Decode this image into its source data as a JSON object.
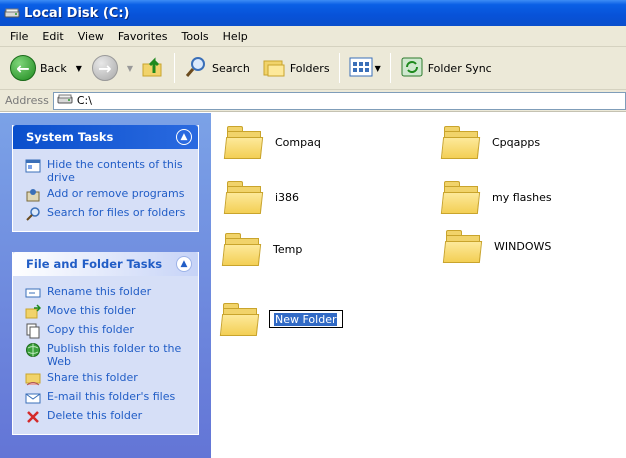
{
  "window": {
    "title": "Local Disk (C:)"
  },
  "menu": [
    "File",
    "Edit",
    "View",
    "Favorites",
    "Tools",
    "Help"
  ],
  "toolbar": {
    "back": "Back",
    "search": "Search",
    "folders": "Folders",
    "folder_sync": "Folder Sync"
  },
  "address": {
    "label": "Address",
    "value": "C:\\"
  },
  "system_tasks": {
    "title": "System Tasks",
    "items": [
      {
        "label": "Hide the contents of this drive",
        "icon": "hide-contents-icon"
      },
      {
        "label": "Add or remove programs",
        "icon": "add-remove-programs-icon"
      },
      {
        "label": "Search for files or folders",
        "icon": "search-icon"
      }
    ]
  },
  "file_folder_tasks": {
    "title": "File and Folder Tasks",
    "items": [
      {
        "label": "Rename this folder",
        "icon": "rename-icon"
      },
      {
        "label": "Move this folder",
        "icon": "move-icon"
      },
      {
        "label": "Copy this folder",
        "icon": "copy-icon"
      },
      {
        "label": "Publish this folder to the Web",
        "icon": "publish-web-icon"
      },
      {
        "label": "Share this folder",
        "icon": "share-icon"
      },
      {
        "label": "E-mail this folder's files",
        "icon": "email-icon"
      },
      {
        "label": "Delete this folder",
        "icon": "delete-icon"
      }
    ]
  },
  "folders": [
    "Compaq",
    "Cpqapps",
    "i386",
    "my flashes",
    "Temp",
    "WINDOWS"
  ],
  "new_folder": {
    "value": "New Folder"
  },
  "colors": {
    "title_bar": "#0752d8",
    "task_link": "#215dc6",
    "selection": "#316ac5"
  }
}
